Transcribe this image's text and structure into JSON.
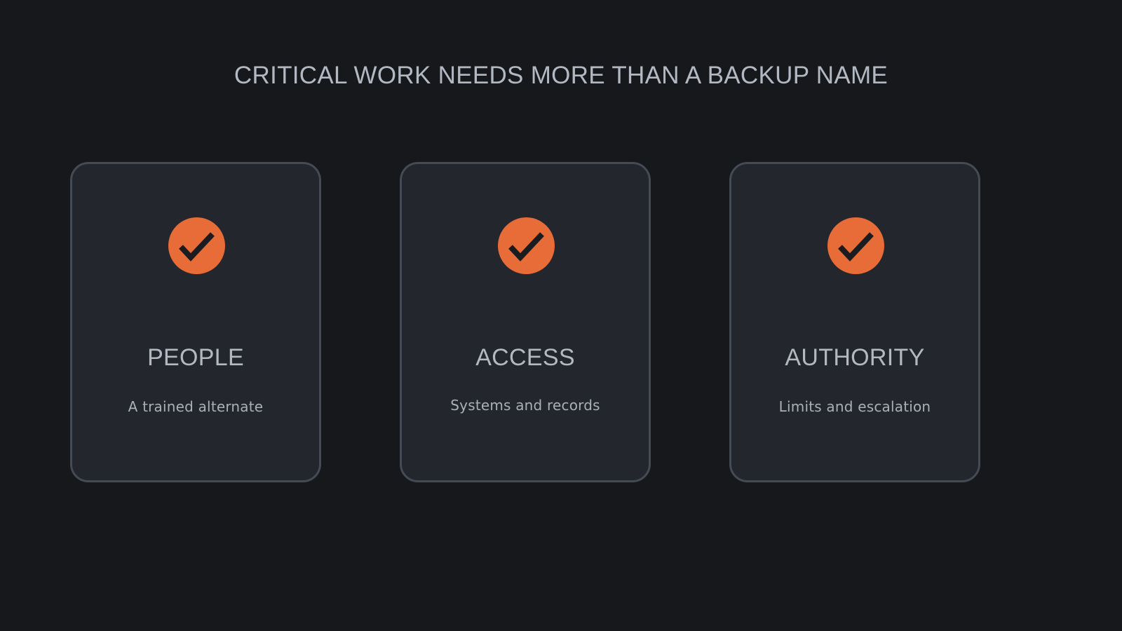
{
  "title": "CRITICAL WORK NEEDS MORE THAN A BACKUP NAME",
  "cards": [
    {
      "heading": "PEOPLE",
      "description": "A trained alternate",
      "icon": "check-circle-icon"
    },
    {
      "heading": "ACCESS",
      "description": "Systems and records",
      "icon": "check-circle-icon"
    },
    {
      "heading": "AUTHORITY",
      "description": "Limits and escalation",
      "icon": "check-circle-icon"
    }
  ],
  "colors": {
    "background": "#16181c",
    "card_background": "#23262c",
    "card_border": "#454b55",
    "accent": "#e76c37",
    "text": "#b3b9c2"
  }
}
